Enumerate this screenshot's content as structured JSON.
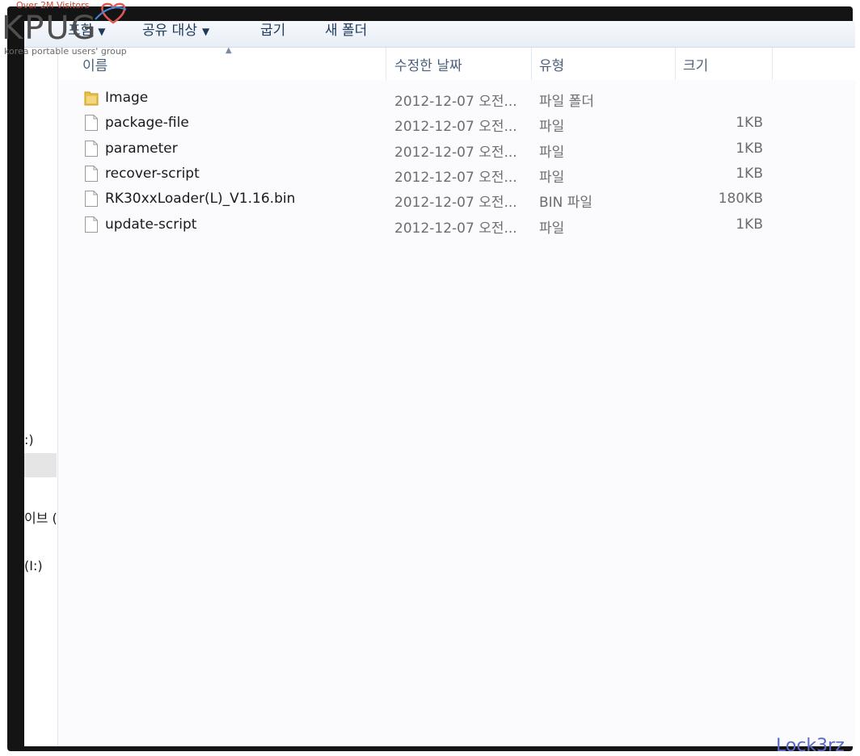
{
  "toolbar": {
    "items": [
      {
        "label": "포함",
        "has_caret": true
      },
      {
        "label": "공유 대상",
        "has_caret": true
      },
      {
        "label": "굽기",
        "has_caret": false
      },
      {
        "label": "새 폴더",
        "has_caret": false
      }
    ]
  },
  "nav_pane": {
    "items": [
      {
        "label": ":)"
      },
      {
        "label": "이브 ("
      },
      {
        "label": "(I:)"
      }
    ]
  },
  "columns": {
    "name": "이름",
    "modified": "수정한 날짜",
    "type": "유형",
    "size": "크기"
  },
  "files": [
    {
      "name": "Image",
      "modified": "2012-12-07 오전...",
      "type": "파일 폴더",
      "size": "",
      "icon": "folder-icon"
    },
    {
      "name": "package-file",
      "modified": "2012-12-07 오전...",
      "type": "파일",
      "size": "1KB",
      "icon": "file-icon"
    },
    {
      "name": "parameter",
      "modified": "2012-12-07 오전...",
      "type": "파일",
      "size": "1KB",
      "icon": "file-icon"
    },
    {
      "name": "recover-script",
      "modified": "2012-12-07 오전...",
      "type": "파일",
      "size": "1KB",
      "icon": "file-icon"
    },
    {
      "name": "RK30xxLoader(L)_V1.16.bin",
      "modified": "2012-12-07 오전...",
      "type": "BIN 파일",
      "size": "180KB",
      "icon": "file-icon"
    },
    {
      "name": "update-script",
      "modified": "2012-12-07 오전...",
      "type": "파일",
      "size": "1KB",
      "icon": "file-icon"
    }
  ],
  "logo": {
    "visitors": "Over 2M Visitors",
    "text": "KPUG",
    "tagline": "korea portable users' group"
  },
  "watermark": "Lock3rz",
  "colors": {
    "frame": "#141414",
    "toolbar_text": "#1e395b",
    "header_text": "#4c607a",
    "folder": "#e8c04a",
    "watermark": "#5a68c8"
  }
}
